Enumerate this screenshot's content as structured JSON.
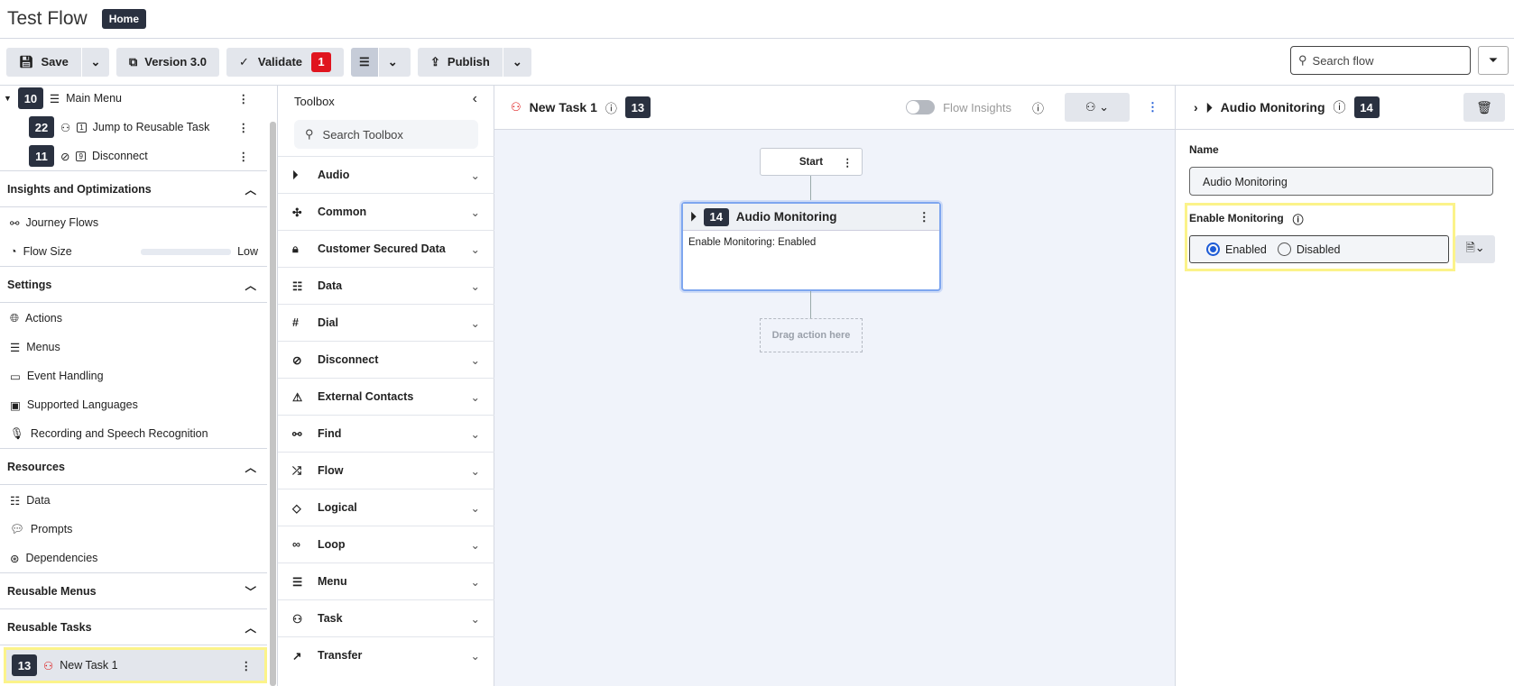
{
  "header": {
    "title": "Test Flow",
    "home": "Home"
  },
  "toolbar": {
    "save": "Save",
    "version": "Version 3.0",
    "validate": "Validate",
    "validate_count": "1",
    "publish": "Publish",
    "search_placeholder": "Search flow"
  },
  "tree": [
    {
      "id": "10",
      "label": "Main Menu"
    },
    {
      "id": "22",
      "label": "Jump to Reusable Task",
      "tag": "1"
    },
    {
      "id": "11",
      "label": "Disconnect",
      "tag": "9"
    }
  ],
  "sections": {
    "insights": {
      "title": "Insights and Optimizations",
      "items": [
        "Journey Flows",
        "Flow Size"
      ],
      "flow_size_value": "Low"
    },
    "settings": {
      "title": "Settings",
      "items": [
        "Actions",
        "Menus",
        "Event Handling",
        "Supported Languages",
        "Recording and Speech Recognition"
      ]
    },
    "resources": {
      "title": "Resources",
      "items": [
        "Data",
        "Prompts",
        "Dependencies"
      ]
    },
    "reusable_menus": {
      "title": "Reusable Menus"
    },
    "reusable_tasks": {
      "title": "Reusable Tasks",
      "items": [
        {
          "id": "13",
          "label": "New Task 1"
        }
      ]
    }
  },
  "toolbox": {
    "title": "Toolbox",
    "search_placeholder": "Search Toolbox",
    "items": [
      "Audio",
      "Common",
      "Customer Secured Data",
      "Data",
      "Dial",
      "Disconnect",
      "External Contacts",
      "Find",
      "Flow",
      "Logical",
      "Loop",
      "Menu",
      "Task",
      "Transfer"
    ]
  },
  "canvas": {
    "task_name": "New Task 1",
    "task_id": "13",
    "flow_insights": "Flow Insights",
    "start": "Start",
    "node": {
      "id": "14",
      "title": "Audio Monitoring",
      "body": "Enable Monitoring: Enabled"
    },
    "drop": "Drag action here"
  },
  "panel": {
    "title": "Audio Monitoring",
    "id": "14",
    "name_label": "Name",
    "name_value": "Audio Monitoring",
    "enable_label": "Enable Monitoring",
    "options": [
      "Enabled",
      "Disabled"
    ],
    "selected": "Enabled"
  },
  "colors": {
    "accent": "#1d5bd6",
    "badge": "#2a3140",
    "error": "#e0141e",
    "highlight": "#fbf38a"
  }
}
